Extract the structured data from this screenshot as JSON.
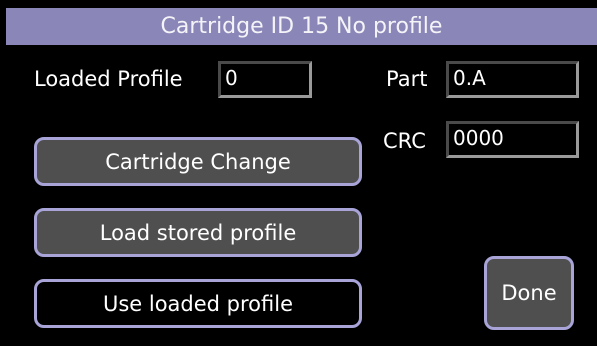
{
  "title": "Cartridge ID 15 No profile",
  "loaded_profile": {
    "label": "Loaded Profile",
    "value": "0"
  },
  "part": {
    "label": "Part",
    "value": "0.A"
  },
  "crc": {
    "label": "CRC",
    "value": "0000"
  },
  "buttons": {
    "cartridge_change": "Cartridge Change",
    "load_stored_profile": "Load stored profile",
    "use_loaded_profile": "Use loaded profile",
    "done": "Done"
  },
  "colors": {
    "title_bar": "#8a86b8",
    "button_border": "#a8a4d8",
    "button_fill": "#4f4f4f",
    "background": "#000000"
  }
}
